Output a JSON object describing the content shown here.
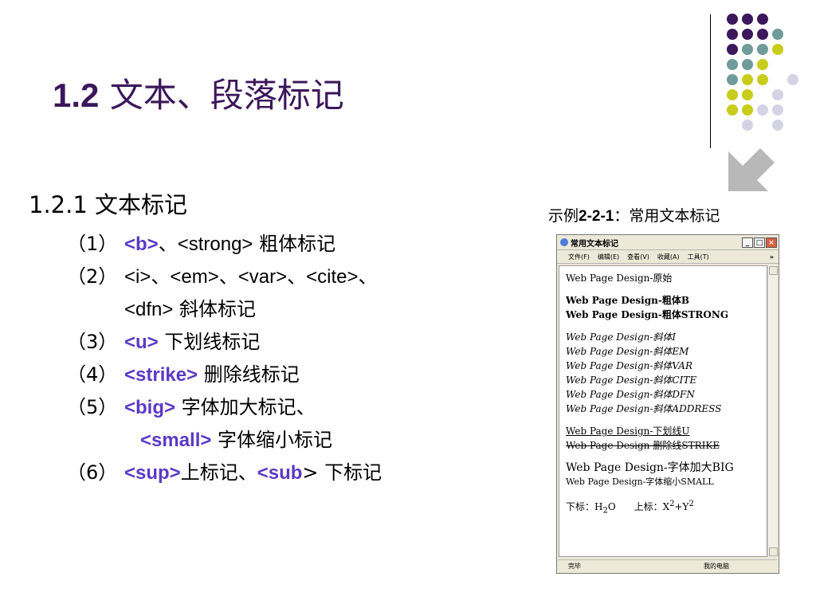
{
  "slide": {
    "title_num": "1.2",
    "title_text": "文本、段落标记",
    "subtitle": "1.2.1 文本标记",
    "items": [
      {
        "no": "（1）",
        "tag": "<b>",
        "tag_sep": "、",
        "tag2": "<strong>",
        "desc": " 粗体标记"
      },
      {
        "no": "（2）",
        "plain": "<i>、<em>、<var>、<cite>、"
      },
      {
        "plain": "<dfn>",
        "desc": " 斜体标记"
      },
      {
        "no": "（3）",
        "tag": "<u>",
        "desc": " 下划线标记"
      },
      {
        "no": "（4）",
        "tag": "<strike>",
        "desc": " 删除线标记"
      },
      {
        "no": "（5）",
        "tag": "<big>",
        "desc": " 字体加大标记、"
      },
      {
        "tag": "<small>",
        "desc": " 字体缩小标记"
      },
      {
        "no": "（6）",
        "tag": "<sup>",
        "desc": "上标记、",
        "tag2": "<sub",
        "tail": "> 下标记"
      }
    ]
  },
  "caption": {
    "prefix": "示例",
    "num": "2-2-1",
    "suffix": "：常用文本标记"
  },
  "browser": {
    "title": "常用文本标记",
    "menu": [
      "文件(F)",
      "编辑(E)",
      "查看(V)",
      "收藏(A)",
      "工具(T)"
    ],
    "more": "»",
    "lines": {
      "original": "Web Page Design-原始",
      "bold_b": "Web Page Design-粗体B",
      "bold_strong": "Web Page Design-粗体STRONG",
      "italic_i": "Web Page Design-斜体I",
      "italic_em": "Web Page Design-斜体EM",
      "italic_var": "Web Page Design-斜体VAR",
      "italic_cite": "Web Page Design-斜体CITE",
      "italic_dfn": "Web Page Design-斜体DFN",
      "italic_address": "Web Page Design-斜体ADDRESS",
      "underline": "Web Page Design-下划线U",
      "strike": "Web Page Design-删除线STRIKE",
      "big": "Web Page Design-字体加大BIG",
      "small": "Web Page Design-字体缩小SMALL",
      "sub_label": "下标：H",
      "sub_2": "2",
      "sub_o": "O",
      "sup_label": "上标：X",
      "sup_2a": "2",
      "sup_plus": "+Y",
      "sup_2b": "2"
    },
    "status_left": "完毕",
    "status_right": "我的电脑"
  }
}
